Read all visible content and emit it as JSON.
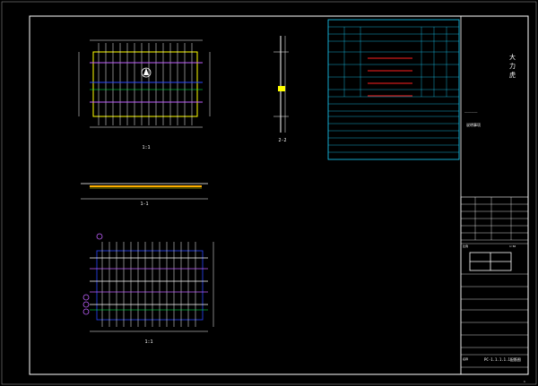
{
  "colors": {
    "background": "#000000",
    "frame": "#ffffff",
    "table": "#19d3ff",
    "accent_red": "#ff2020",
    "yellow": "#ffff00",
    "green": "#00ff55",
    "magenta": "#c060ff",
    "blue": "#2b48ff",
    "orange": "#ffae00"
  },
  "views": {
    "plan_top": {
      "label": "1:1"
    },
    "section_side": {
      "label": "2-2"
    },
    "section_long": {
      "label": "1-1"
    },
    "plan_bottom": {
      "label": "1:1"
    }
  },
  "right_stamp": {
    "chars": [
      "大",
      "力",
      "虎"
    ],
    "small_text": "————————",
    "note": "说明事项"
  },
  "title_block": {
    "header_cells": [
      "",
      "",
      ""
    ],
    "rows": [
      "",
      "",
      "",
      "",
      "",
      ""
    ],
    "scale_label": "比例",
    "scale_value": "1:50",
    "name_label": "名称",
    "drawing_title": "PC-1.1.1.1.1配筋图",
    "sheet_no": "1"
  },
  "icons": [
    "section-marker-icon",
    "north-arrow-icon",
    "dimension-arrow-icon"
  ]
}
